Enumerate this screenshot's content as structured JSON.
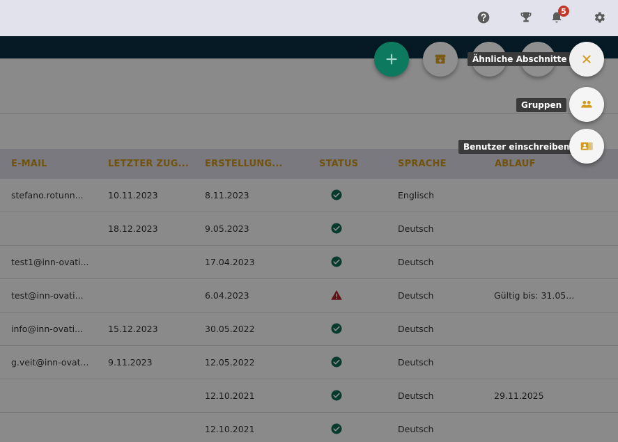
{
  "topbar": {
    "notification_count": "5",
    "icons": [
      "help-icon",
      "trophy-icon",
      "bell-icon",
      "gear-icon"
    ]
  },
  "table": {
    "headers": [
      "E-MAIL",
      "LETZTER ZUG...",
      "ERSTELLUNG...",
      "STATUS",
      "SPRACHE",
      "ABLAUF"
    ],
    "rows": [
      {
        "email": "stefano.rotunn...",
        "last": "10.11.2023",
        "created": "8.11.2023",
        "status": "ok",
        "lang": "Englisch",
        "expiry": ""
      },
      {
        "email": "",
        "last": "18.12.2023",
        "created": "9.05.2023",
        "status": "ok",
        "lang": "Deutsch",
        "expiry": ""
      },
      {
        "email": "test1@inn-ovati...",
        "last": "",
        "created": "17.04.2023",
        "status": "ok",
        "lang": "Deutsch",
        "expiry": ""
      },
      {
        "email": "test@inn-ovati...",
        "last": "",
        "created": "6.04.2023",
        "status": "warning",
        "lang": "Deutsch",
        "expiry": "Gültig bis: 31.05..."
      },
      {
        "email": "info@inn-ovati...",
        "last": "15.12.2023",
        "created": "30.05.2022",
        "status": "ok",
        "lang": "Deutsch",
        "expiry": ""
      },
      {
        "email": "g.veit@inn-ovat...",
        "last": "9.11.2023",
        "created": "12.05.2022",
        "status": "ok",
        "lang": "Deutsch",
        "expiry": ""
      },
      {
        "email": "",
        "last": "",
        "created": "12.10.2021",
        "status": "ok",
        "lang": "Deutsch",
        "expiry": "29.11.2025"
      },
      {
        "email": "",
        "last": "",
        "created": "12.10.2021",
        "status": "ok",
        "lang": "Deutsch",
        "expiry": ""
      }
    ]
  },
  "fab_menu": {
    "similar_sections_label": "Ähnliche Abschnitte",
    "groups_label": "Gruppen",
    "enroll_users_label": "Benutzer einschreiben"
  },
  "colors": {
    "accent": "#d19a1a",
    "primary_fab": "#0d7a5f",
    "ok_status": "#0b6b52",
    "warning_status": "#b3262b",
    "nav": "#0b3045"
  }
}
